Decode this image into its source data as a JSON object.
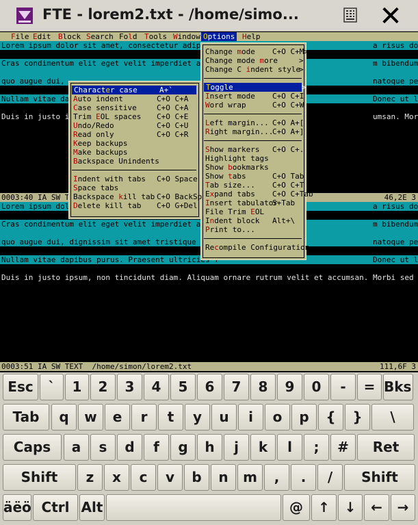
{
  "window": {
    "title": "FTE - lorem2.txt - /home/simo...",
    "close_glyph": "✕"
  },
  "menubar": [
    {
      "label": "File",
      "hot": 0
    },
    {
      "label": "Edit",
      "hot": 0
    },
    {
      "label": "Block",
      "hot": 0
    },
    {
      "label": "Search",
      "hot": 0
    },
    {
      "label": "Fold",
      "hot": 2
    },
    {
      "label": "Tools",
      "hot": 0
    },
    {
      "label": "Window",
      "hot": 0
    },
    {
      "label": "Options",
      "hot": 0
    },
    {
      "label": "Help",
      "hot": 0
    }
  ],
  "editor_top": {
    "lines": [
      {
        "text": "Lorem ipsum dolor sit amet, consectetur adipisci                                  a risus dolor, quo eget",
        "style": "c"
      },
      {
        "text": "",
        "style": "k"
      },
      {
        "text": "Cras condimentum elit eget velit imperdiet ac co                                  m bibendum magna non te",
        "style": "c"
      },
      {
        "text": "",
        "style": "c"
      },
      {
        "text": "quo augue dui,                                                                    natoque penatibus et ma",
        "style": "c"
      },
      {
        "text": "",
        "style": "k"
      },
      {
        "text": "Nullam vitae dap                                                                  Donec ut leo nisl. Morbi",
        "style": "c"
      },
      {
        "text": "",
        "style": "k"
      },
      {
        "text": "Duis in justo ip                                                                  umsan. Morbi sed lorem la",
        "style": "k"
      }
    ],
    "status_left": "0003:40 IA SW TEXT",
    "status_right": "46,2E 3"
  },
  "editor_bottom": {
    "lines": [
      {
        "text": "Lorem ipsum dolor sit amet, consectetur adipisci                                  a risus dolor, quo eget",
        "style": "c"
      },
      {
        "text": "",
        "style": "k"
      },
      {
        "text": "Cras condimentum elit eget velit imperdiet ac co                                  m bibendum magna non te",
        "style": "c"
      },
      {
        "text": "",
        "style": "c"
      },
      {
        "text": "quo augue dui, dignissim sit amet tristique nec,                                  natoque penatibus et ma",
        "style": "c"
      },
      {
        "text": "",
        "style": "k"
      },
      {
        "text": "Nullam vitae dapibus purus. Praesent ultricies f                                  Donec ut leo nisl. Morbi",
        "style": "c"
      },
      {
        "text": "",
        "style": "k"
      },
      {
        "text": "Duis in justo ipsum, non tincidunt diam. Aliquam ornare rutrum velit et accumsan. Morbi sed lorem la",
        "style": "k"
      }
    ],
    "status_left": "0003:51 IA SW TEXT  /home/simon/lorem2.txt",
    "status_right": "111,6F 3"
  },
  "options_menu": [
    {
      "label": "Change mode",
      "hot": 7,
      "acc": "C+O C+M>"
    },
    {
      "label": "Change mode more",
      "hot": 12,
      "acc": ">"
    },
    {
      "label": "Change C indent style",
      "hot": 9,
      "acc": ">"
    },
    {
      "sep": true
    },
    {
      "label": "Toggle",
      "hot": 0,
      "acc": ">",
      "selected": true
    },
    {
      "label": "Insert mode",
      "hot": 0,
      "acc": "C+O C+I"
    },
    {
      "label": "Word wrap",
      "hot": 0,
      "acc": "C+O C+W"
    },
    {
      "sep": true
    },
    {
      "label": "Left margin...",
      "hot": 0,
      "acc": "C+O A+["
    },
    {
      "label": "Right margin...",
      "hot": 0,
      "acc": "C+O A+]"
    },
    {
      "sep": true
    },
    {
      "label": "Show markers",
      "hot": 0,
      "acc": "C+O C+."
    },
    {
      "label": "Highlight tags",
      "hot": -1,
      "acc": ""
    },
    {
      "label": "Show bookmarks",
      "hot": 5,
      "acc": ""
    },
    {
      "label": "Show tabs",
      "hot": 5,
      "acc": "C+O Tab"
    },
    {
      "label": "Tab size...",
      "hot": 0,
      "acc": "C+O C+T"
    },
    {
      "label": "Expand tabs",
      "hot": 1,
      "acc": "C+O C+Tab"
    },
    {
      "label": "Insert tabulator",
      "hot": 0,
      "acc": "S+Tab"
    },
    {
      "label": "File Trim EOL",
      "hot": 10,
      "acc": ""
    },
    {
      "label": "Indent block",
      "hot": 1,
      "acc": "Alt+\\"
    },
    {
      "label": "Print to...",
      "hot": 0,
      "acc": ""
    },
    {
      "sep": true
    },
    {
      "label": "Recompile Configuration",
      "hot": 2,
      "acc": ""
    }
  ],
  "toggle_menu": [
    {
      "label": "Character case",
      "hot": 7,
      "acc": "A+`",
      "selected": true
    },
    {
      "label": "Auto indent",
      "hot": 0,
      "acc": "C+O C+A"
    },
    {
      "label": "Case sensitive",
      "hot": 0,
      "acc": "C+O C+A"
    },
    {
      "label": "Trim EOL spaces",
      "hot": 5,
      "acc": "C+O C+E"
    },
    {
      "label": "Undo/Redo",
      "hot": 0,
      "acc": "C+O C+U"
    },
    {
      "label": "Read only",
      "hot": 0,
      "acc": "C+O C+R"
    },
    {
      "label": "Keep backups",
      "hot": 0,
      "acc": ""
    },
    {
      "label": "Make backups",
      "hot": 0,
      "acc": ""
    },
    {
      "label": "Backspace Unindents",
      "hot": 0,
      "acc": ""
    },
    {
      "sep": true
    },
    {
      "label": "Indent with tabs",
      "hot": 0,
      "acc": "C+O Space"
    },
    {
      "label": "Space tabs",
      "hot": 0,
      "acc": ""
    },
    {
      "label": "Backspace kill tab",
      "hot": 10,
      "acc": "C+O BackSp"
    },
    {
      "label": "Delete kill tab",
      "hot": 0,
      "acc": "C+O G+Del"
    }
  ],
  "keyboard": [
    [
      "Esc",
      "`",
      "1",
      "2",
      "3",
      "4",
      "5",
      "6",
      "7",
      "8",
      "9",
      "0",
      "-",
      "=",
      "Bksp"
    ],
    [
      "Tab",
      "q",
      "w",
      "e",
      "r",
      "t",
      "y",
      "u",
      "i",
      "o",
      "p",
      "{",
      "}",
      "\\"
    ],
    [
      "Caps",
      "a",
      "s",
      "d",
      "f",
      "g",
      "h",
      "j",
      "k",
      "l",
      ";",
      "#",
      "Ret"
    ],
    [
      "Shift",
      "z",
      "x",
      "c",
      "v",
      "b",
      "n",
      "m",
      ",",
      ".",
      "/",
      "Shift"
    ],
    [
      "äëö",
      "Ctrl",
      "Alt",
      "",
      "@",
      "↑",
      "↓",
      "←",
      "→"
    ]
  ]
}
